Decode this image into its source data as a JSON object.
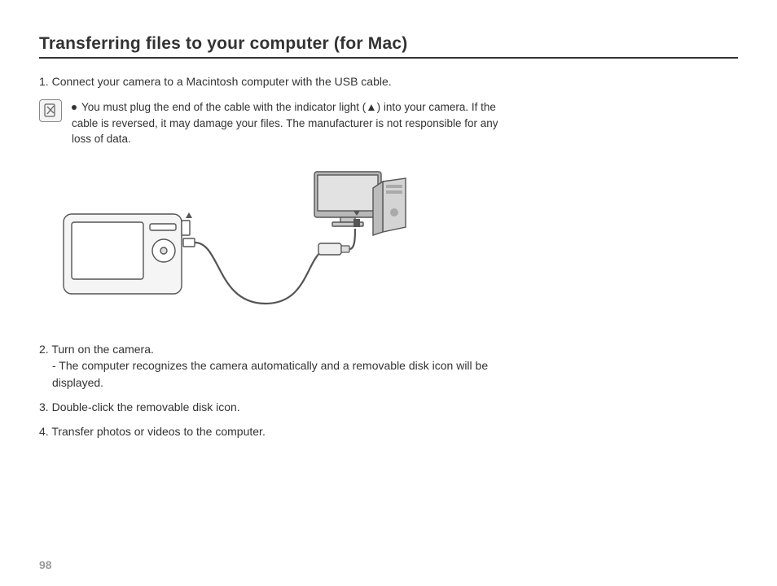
{
  "title": "Transferring files to your computer (for Mac)",
  "step1": {
    "num": "1",
    "text": "Connect your camera to a Macintosh computer with the USB cable."
  },
  "note": {
    "text": "You must plug the end of the cable with the indicator light (▲) into your camera. If the cable is reversed, it may damage your files. The manufacturer is not responsible for any loss of data."
  },
  "step2": {
    "num": "2",
    "text": "Turn on the camera.",
    "sub": "- The computer recognizes the camera automatically and a removable disk icon will be displayed."
  },
  "step3": {
    "num": "3",
    "text": "Double-click the removable disk icon."
  },
  "step4": {
    "num": "4",
    "text": "Transfer photos or videos to the computer."
  },
  "page_number": "98"
}
